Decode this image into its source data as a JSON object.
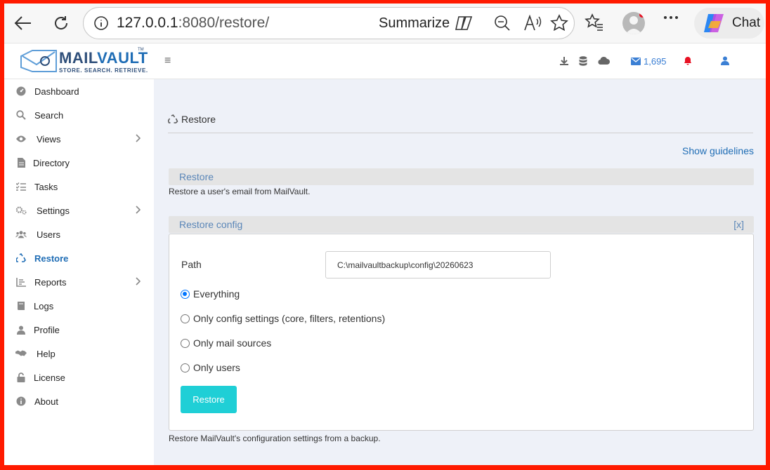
{
  "browser": {
    "url_host": "127.0.0.1",
    "url_port_path": ":8080/restore/",
    "summarize_label": "Summarize",
    "chat_label": "Chat"
  },
  "header": {
    "brand_prefix": "MAIL",
    "brand_suffix": "VAULT",
    "tagline": "STORE. SEARCH. RETRIEVE.",
    "trademark": "TM",
    "hamburger": "≡",
    "mail_count": "1,695"
  },
  "sidebar": {
    "items": [
      {
        "label": "Dashboard",
        "icon": "dashboard-icon",
        "chevron": false
      },
      {
        "label": "Search",
        "icon": "search-icon",
        "chevron": false
      },
      {
        "label": "Views",
        "icon": "eye-icon",
        "chevron": true
      },
      {
        "label": "Directory",
        "icon": "file-icon",
        "chevron": false
      },
      {
        "label": "Tasks",
        "icon": "tasks-icon",
        "chevron": false
      },
      {
        "label": "Settings",
        "icon": "gears-icon",
        "chevron": true
      },
      {
        "label": "Users",
        "icon": "users-icon",
        "chevron": false
      },
      {
        "label": "Restore",
        "icon": "recycle-icon",
        "chevron": false,
        "active": true
      },
      {
        "label": "Reports",
        "icon": "chart-icon",
        "chevron": true
      },
      {
        "label": "Logs",
        "icon": "book-icon",
        "chevron": false
      },
      {
        "label": "Profile",
        "icon": "user-icon",
        "chevron": false
      },
      {
        "label": "Help",
        "icon": "handshake-icon",
        "chevron": false
      },
      {
        "label": "License",
        "icon": "lock-icon",
        "chevron": false
      },
      {
        "label": "About",
        "icon": "info-icon",
        "chevron": false
      }
    ]
  },
  "main": {
    "page_title": "Restore",
    "guidelines_link": "Show guidelines",
    "restore_section": {
      "title": "Restore",
      "description": "Restore a user's email from MailVault."
    },
    "config_section": {
      "title": "Restore config",
      "close": "[x]",
      "path_label": "Path",
      "path_value": "C:\\mailvaultbackup\\config\\20260623",
      "options": [
        {
          "label": "Everything",
          "selected": true
        },
        {
          "label": "Only config settings (core, filters, retentions)",
          "selected": false
        },
        {
          "label": "Only mail sources",
          "selected": false
        },
        {
          "label": "Only users",
          "selected": false
        }
      ],
      "restore_button": "Restore",
      "footer_description": "Restore MailVault's configuration settings from a backup."
    }
  },
  "colors": {
    "accent": "#1f6db5",
    "button": "#1fcfd6",
    "notification": "#e81123",
    "frame": "#ff1a00"
  }
}
